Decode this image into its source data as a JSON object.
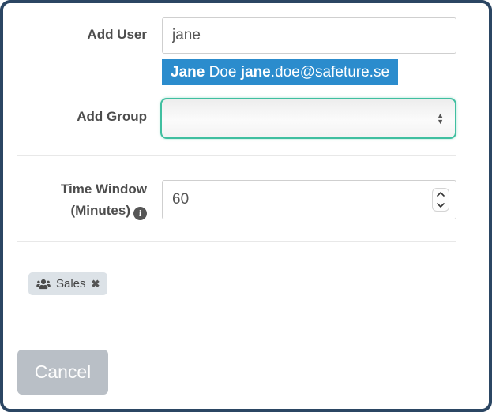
{
  "form": {
    "add_user": {
      "label": "Add User",
      "value": "jane"
    },
    "suggestion": {
      "full_text": "Jane Doe jane.doe@safeture.se",
      "segments": [
        {
          "text": "Jane",
          "bold": true
        },
        {
          "text": " Doe ",
          "bold": false
        },
        {
          "text": "jane",
          "bold": true
        },
        {
          "text": ".doe@safeture.se",
          "bold": false
        }
      ]
    },
    "add_group": {
      "label": "Add Group",
      "selected_value": ""
    },
    "time_window": {
      "label_line1": "Time Window",
      "label_line2": "(Minutes)",
      "value": "60"
    },
    "tags": [
      {
        "label": "Sales"
      }
    ],
    "cancel_label": "Cancel"
  },
  "icons": {
    "info": "i",
    "users": "users-glyph",
    "tag_close": "✖",
    "select_arrow_up": "▲",
    "select_arrow_down": "▼"
  },
  "colors": {
    "frame_border": "#2b4663",
    "suggestion_bg": "#2b8ccd",
    "select_border": "#40bfa0",
    "divider": "#e8e8e8",
    "label_text": "#4d4d4d",
    "tag_bg": "#dce2e7",
    "cancel_bg": "#b9bfc6"
  }
}
